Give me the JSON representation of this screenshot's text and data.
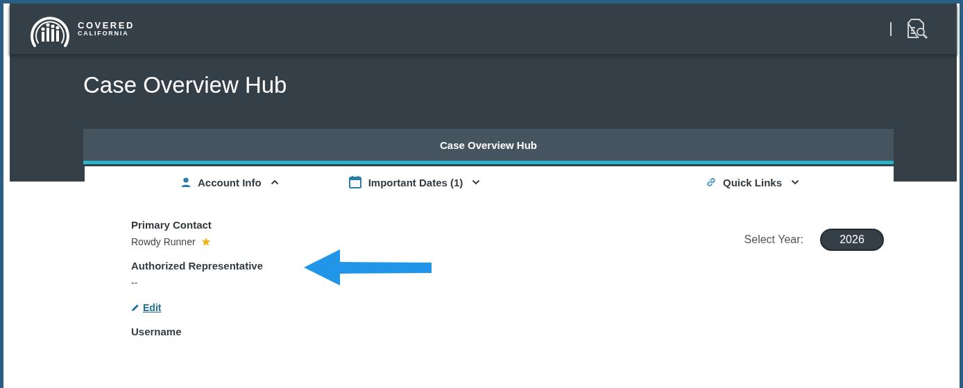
{
  "header": {
    "logo_line1": "COVERED",
    "logo_line2": "CALIFORNIA"
  },
  "page_title": "Case Overview Hub",
  "card_title": "Case Overview Hub",
  "sections": [
    {
      "label": "Account Info",
      "kind": "person",
      "expanded": true
    },
    {
      "label": "Important Dates (1)",
      "kind": "calendar",
      "expanded": false
    },
    {
      "label": "Quick Links",
      "kind": "link",
      "expanded": false
    }
  ],
  "fields": [
    {
      "label": "Primary Contact",
      "value": "Rowdy Runner",
      "starred": true
    },
    {
      "label": "Authorized Representative",
      "value": "--",
      "edit_link": "Edit"
    },
    {
      "label": "Username"
    }
  ],
  "year_select": {
    "label": "Select Year:",
    "value": "2026"
  }
}
